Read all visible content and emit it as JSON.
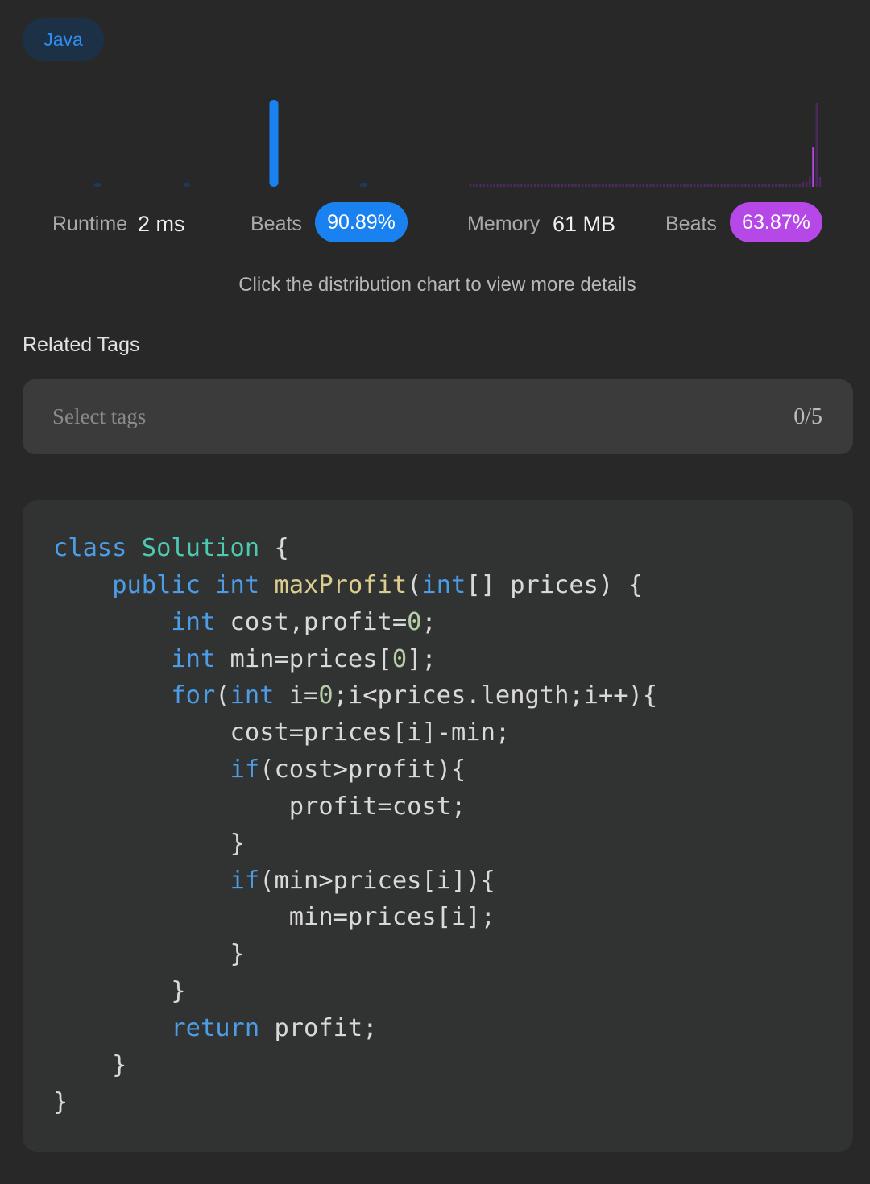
{
  "language_tag": "Java",
  "runtime": {
    "label": "Runtime",
    "value": "2 ms",
    "beats_label": "Beats",
    "beats_value": "90.89%",
    "accent": "#1a82f0"
  },
  "memory": {
    "label": "Memory",
    "value": "61 MB",
    "beats_label": "Beats",
    "beats_value": "63.87%",
    "accent": "#b548e6"
  },
  "chart_data": [
    {
      "type": "bar",
      "series": [
        {
          "values": [
            1,
            1,
            36,
            1
          ]
        }
      ],
      "highlight_index": 2,
      "color": "#1a82f0"
    },
    {
      "type": "bar",
      "series": [
        {
          "values": [
            1,
            1,
            1,
            1,
            1,
            1,
            1,
            1,
            1,
            1,
            1,
            1,
            1,
            1,
            1,
            1,
            1,
            1,
            1,
            1,
            1,
            1,
            1,
            1,
            1,
            1,
            1,
            1,
            1,
            1,
            1,
            1,
            1,
            1,
            1,
            1,
            1,
            1,
            1,
            1,
            1,
            1,
            1,
            1,
            1,
            1,
            1,
            1,
            1,
            1,
            1,
            1,
            1,
            1,
            1,
            1,
            1,
            1,
            1,
            1,
            1,
            1,
            1,
            1,
            1,
            1,
            1,
            1,
            1,
            1,
            1,
            1,
            1,
            1,
            1,
            1,
            1,
            1,
            1,
            1,
            1,
            1,
            1,
            1,
            1,
            1,
            1,
            1,
            1,
            1,
            1,
            1,
            1,
            1,
            1,
            1,
            1,
            1,
            2,
            2,
            4,
            16,
            34,
            4
          ]
        }
      ],
      "highlight_index": 101,
      "color": "#b548e6"
    }
  ],
  "hint": "Click the distribution chart to view more details",
  "related_tags": {
    "title": "Related Tags",
    "placeholder": "Select tags",
    "count": "0/5"
  },
  "code": {
    "language": "java",
    "lines": [
      [
        {
          "t": "class",
          "k": "kw"
        },
        {
          "t": " "
        },
        {
          "t": "Solution",
          "k": "cls"
        },
        {
          "t": " {"
        }
      ],
      [
        {
          "t": "    "
        },
        {
          "t": "public",
          "k": "kw"
        },
        {
          "t": " "
        },
        {
          "t": "int",
          "k": "kw"
        },
        {
          "t": " "
        },
        {
          "t": "maxProfit",
          "k": "fn"
        },
        {
          "t": "("
        },
        {
          "t": "int",
          "k": "kw"
        },
        {
          "t": "[] prices) {"
        }
      ],
      [
        {
          "t": "        "
        },
        {
          "t": "int",
          "k": "kw"
        },
        {
          "t": " cost,profit="
        },
        {
          "t": "0",
          "k": "num"
        },
        {
          "t": ";"
        }
      ],
      [
        {
          "t": "        "
        },
        {
          "t": "int",
          "k": "kw"
        },
        {
          "t": " min=prices["
        },
        {
          "t": "0",
          "k": "num"
        },
        {
          "t": "];"
        }
      ],
      [
        {
          "t": "        "
        },
        {
          "t": "for",
          "k": "kw"
        },
        {
          "t": "("
        },
        {
          "t": "int",
          "k": "kw"
        },
        {
          "t": " i="
        },
        {
          "t": "0",
          "k": "num"
        },
        {
          "t": ";i<prices.length;i++){"
        }
      ],
      [
        {
          "t": "            cost=prices[i]-min;"
        }
      ],
      [
        {
          "t": "            "
        },
        {
          "t": "if",
          "k": "kw"
        },
        {
          "t": "(cost>profit){"
        }
      ],
      [
        {
          "t": "                profit=cost;"
        }
      ],
      [
        {
          "t": "            }"
        }
      ],
      [
        {
          "t": "            "
        },
        {
          "t": "if",
          "k": "kw"
        },
        {
          "t": "(min>prices[i]){"
        }
      ],
      [
        {
          "t": "                min=prices[i];"
        }
      ],
      [
        {
          "t": "            }"
        }
      ],
      [
        {
          "t": "        }"
        }
      ],
      [
        {
          "t": "        "
        },
        {
          "t": "return",
          "k": "kw"
        },
        {
          "t": " profit;"
        }
      ],
      [
        {
          "t": "    }"
        }
      ],
      [
        {
          "t": "}"
        }
      ]
    ]
  }
}
